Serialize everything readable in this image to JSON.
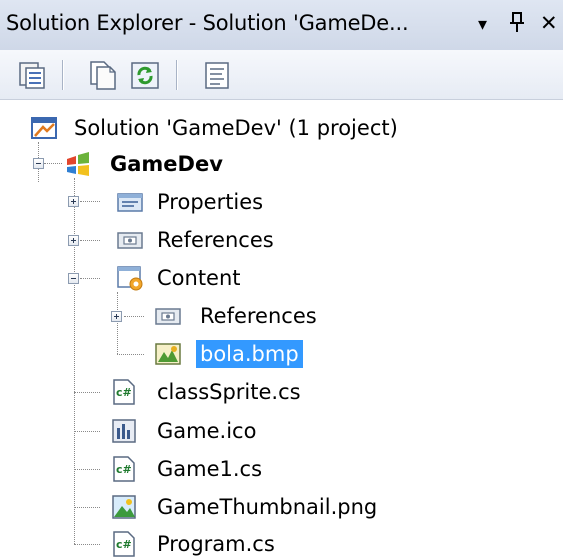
{
  "window": {
    "title": "Solution Explorer - Solution 'GameDe...",
    "dropdown_glyph": "▾",
    "pin_glyph": "⊥",
    "close_glyph": "✕"
  },
  "toolbar": {
    "buttons": [
      {
        "name": "properties-button",
        "icon": "properties-icon"
      },
      {
        "name": "show-all-files-button",
        "icon": "show-all-files-icon"
      },
      {
        "name": "refresh-button",
        "icon": "refresh-icon"
      },
      {
        "name": "view-class-diagram-button",
        "icon": "class-diagram-icon"
      }
    ]
  },
  "tree": {
    "solution": {
      "label": "Solution 'GameDev' (1 project)",
      "icon": "solution-icon"
    },
    "project": {
      "label": "GameDev",
      "icon": "csharp-project-icon",
      "expanded": true
    },
    "items": [
      {
        "label": "Properties",
        "icon": "properties-folder-icon",
        "expander": "plus"
      },
      {
        "label": "References",
        "icon": "references-folder-icon",
        "expander": "plus"
      },
      {
        "label": "Content",
        "icon": "content-project-icon",
        "expander": "minus"
      },
      {
        "label": "References",
        "icon": "references-folder-icon",
        "expander": "plus",
        "child": true
      },
      {
        "label": "bola.bmp",
        "icon": "bitmap-file-icon",
        "child": true,
        "selected": true
      },
      {
        "label": "classSprite.cs",
        "icon": "csharp-file-icon"
      },
      {
        "label": "Game.ico",
        "icon": "icon-file-icon"
      },
      {
        "label": "Game1.cs",
        "icon": "csharp-file-icon"
      },
      {
        "label": "GameThumbnail.png",
        "icon": "png-image-icon"
      },
      {
        "label": "Program.cs",
        "icon": "csharp-file-icon"
      }
    ]
  },
  "colors": {
    "selection": "#3399ff",
    "titlebar": "#dfe6f2"
  }
}
